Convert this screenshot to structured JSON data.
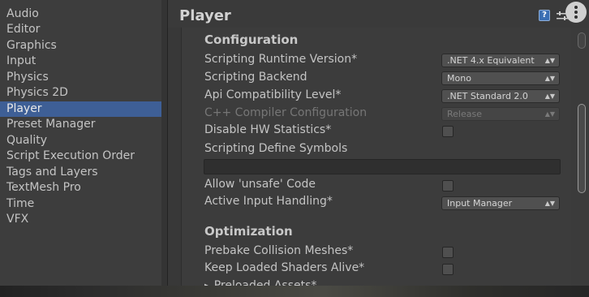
{
  "sidebar": {
    "items": [
      {
        "label": "Audio"
      },
      {
        "label": "Editor"
      },
      {
        "label": "Graphics"
      },
      {
        "label": "Input"
      },
      {
        "label": "Physics"
      },
      {
        "label": "Physics 2D"
      },
      {
        "label": "Player",
        "selected": true
      },
      {
        "label": "Preset Manager"
      },
      {
        "label": "Quality"
      },
      {
        "label": "Script Execution Order"
      },
      {
        "label": "Tags and Layers"
      },
      {
        "label": "TextMesh Pro"
      },
      {
        "label": "Time"
      },
      {
        "label": "VFX"
      }
    ]
  },
  "header": {
    "title": "Player",
    "help_icon": "help-icon",
    "preset_icon": "preset-sliders-icon",
    "more_icon": "more-options-icon"
  },
  "configuration": {
    "title": "Configuration",
    "scripting_runtime_version": {
      "label": "Scripting Runtime Version*",
      "value": ".NET 4.x Equivalent"
    },
    "scripting_backend": {
      "label": "Scripting Backend",
      "value": "Mono"
    },
    "api_compatibility_level": {
      "label": "Api Compatibility Level*",
      "value": ".NET Standard 2.0"
    },
    "cpp_compiler_configuration": {
      "label": "C++ Compiler Configuration",
      "value": "Release",
      "disabled": true
    },
    "disable_hw_statistics": {
      "label": "Disable HW Statistics*",
      "checked": false
    },
    "scripting_define_symbols": {
      "label": "Scripting Define Symbols",
      "value": ""
    },
    "allow_unsafe_code": {
      "label": "Allow 'unsafe' Code",
      "checked": false
    },
    "active_input_handling": {
      "label": "Active Input Handling*",
      "value": "Input Manager"
    }
  },
  "optimization": {
    "title": "Optimization",
    "prebake_collision_meshes": {
      "label": "Prebake Collision Meshes*",
      "checked": false
    },
    "keep_loaded_shaders_alive": {
      "label": "Keep Loaded Shaders Alive*",
      "checked": false
    },
    "preloaded_assets": {
      "label": "Preloaded Assets*"
    }
  },
  "colors": {
    "selection": "#3e5f96",
    "background": "#383838",
    "text": "#c4c4c4"
  }
}
